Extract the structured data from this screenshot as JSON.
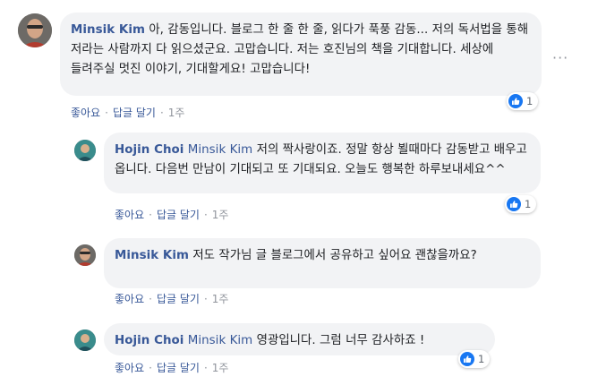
{
  "comments": [
    {
      "author": "Minsik Kim",
      "mention": "",
      "text": "아, 감동입니다. 블로그 한 줄 한 줄, 읽다가 푹풍 감동... 저의 독서법을 통해 저라는 사람까지 다 읽으셨군요. 고맙습니다. 저는 호진님의 책을 기대합니다. 세상에 들려주실 멋진 이야기, 기대할게요! 고맙습니다!",
      "like_label": "좋아요",
      "reply_label": "답글 달기",
      "time": "1주",
      "reaction_count": "1"
    },
    {
      "author": "Hojin Choi",
      "mention": "Minsik Kim",
      "text": "저의 짝사랑이죠. 정말 항상 뵐때마다 감동받고 배우고 옵니다. 다음번 만남이 기대되고 또 기대되요. 오늘도 행복한 하루보내세요^^",
      "like_label": "좋아요",
      "reply_label": "답글 달기",
      "time": "1주",
      "reaction_count": "1"
    },
    {
      "author": "Minsik Kim",
      "mention": "",
      "text": "저도 작가님 글 블로그에서 공유하고 싶어요 괜찮을까요?",
      "like_label": "좋아요",
      "reply_label": "답글 달기",
      "time": "1주",
      "reaction_count": ""
    },
    {
      "author": "Hojin Choi",
      "mention": "Minsik Kim",
      "text": "영광입니다. 그럼 너무 감사하죠 !",
      "like_label": "좋아요",
      "reply_label": "답글 달기",
      "time": "1주",
      "reaction_count": "1"
    }
  ],
  "separator": "·",
  "more_icon": "more-options-icon",
  "reaction_icon": "thumbs-up-icon",
  "colors": {
    "bubble": "#f2f3f5",
    "author": "#385898",
    "like_blue": "#1877f2",
    "meta_gray": "#90949c"
  }
}
